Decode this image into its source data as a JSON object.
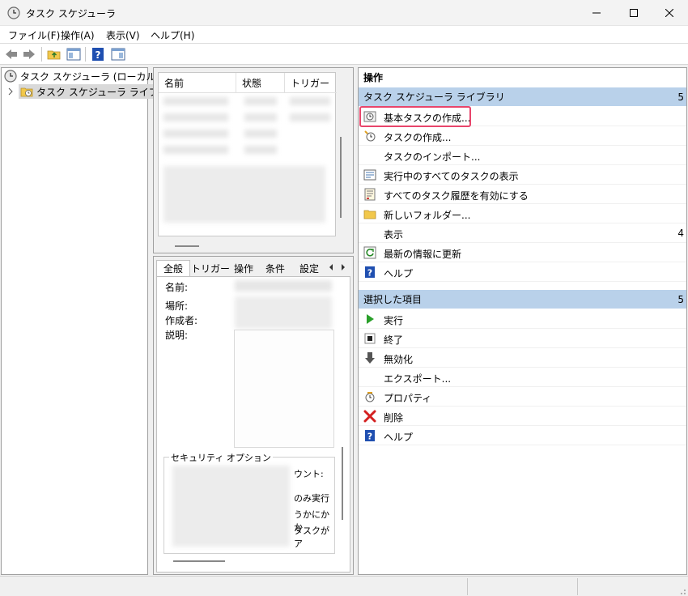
{
  "window": {
    "title": "タスク スケジューラ"
  },
  "menu": [
    {
      "label": "ファイル(F)"
    },
    {
      "label": "操作(A)"
    },
    {
      "label": "表示(V)"
    },
    {
      "label": "ヘルプ(H)"
    }
  ],
  "tree": {
    "root": "タスク スケジューラ (ローカル)",
    "library": "タスク スケジューラ ライブラリ"
  },
  "task_list": {
    "columns": [
      "名前",
      "状態",
      "トリガー"
    ]
  },
  "details": {
    "tabs": [
      "全般",
      "トリガー",
      "操作",
      "条件",
      "設定"
    ],
    "labels": {
      "name": "名前:",
      "location": "場所:",
      "author": "作成者:",
      "description": "説明:"
    },
    "security_title": "セキュリティ オプション",
    "security_snippets": [
      "ウント:",
      "のみ実行",
      "うかにかか",
      "タスクがア"
    ]
  },
  "actions": {
    "pane_title": "操作",
    "section1": {
      "title": "タスク スケジューラ ライブラリ",
      "count": "5"
    },
    "items1": [
      {
        "label": "基本タスクの作成...",
        "icon": "basic-task-icon"
      },
      {
        "label": "タスクの作成...",
        "icon": "create-task-icon"
      },
      {
        "label": "タスクのインポート...",
        "icon": ""
      },
      {
        "label": "実行中のすべてのタスクの表示",
        "icon": "running-tasks-icon"
      },
      {
        "label": "すべてのタスク履歴を有効にする",
        "icon": "history-icon"
      },
      {
        "label": "新しいフォルダー...",
        "icon": "folder-icon"
      },
      {
        "label": "表示",
        "icon": "",
        "count": "4"
      },
      {
        "label": "最新の情報に更新",
        "icon": "refresh-icon"
      },
      {
        "label": "ヘルプ",
        "icon": "help-icon"
      }
    ],
    "section2": {
      "title": "選択した項目",
      "count": "5"
    },
    "items2": [
      {
        "label": "実行",
        "icon": "run-icon"
      },
      {
        "label": "終了",
        "icon": "stop-icon"
      },
      {
        "label": "無効化",
        "icon": "disable-icon"
      },
      {
        "label": "エクスポート...",
        "icon": ""
      },
      {
        "label": "プロパティ",
        "icon": "properties-icon"
      },
      {
        "label": "削除",
        "icon": "delete-icon"
      },
      {
        "label": "ヘルプ",
        "icon": "help-icon"
      }
    ]
  },
  "colors": {
    "section_header": "#b9d1ea",
    "highlight_box": "#e8456b"
  }
}
